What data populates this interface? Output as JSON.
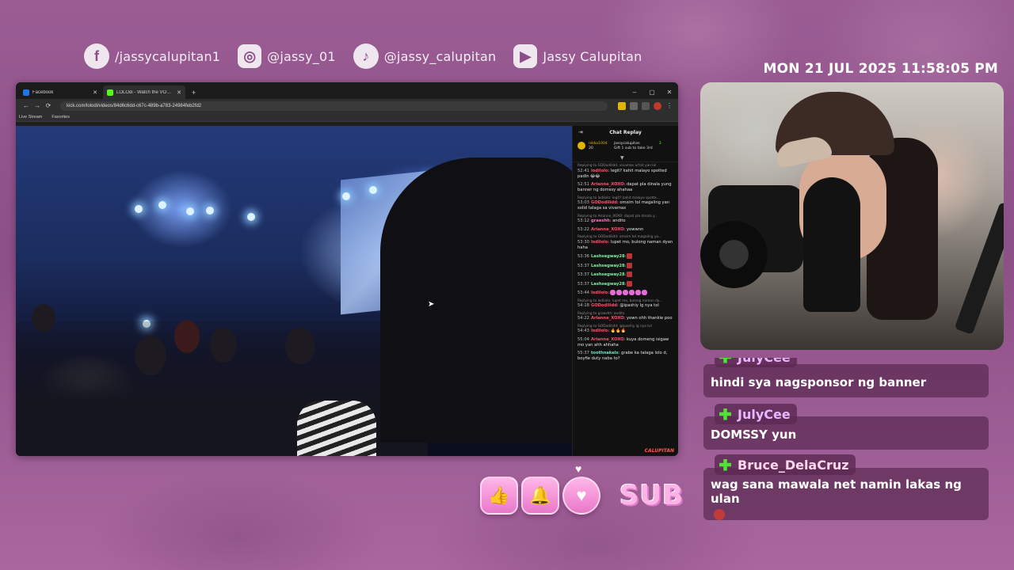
{
  "socials": [
    {
      "icon": "facebook-icon",
      "glyph": "f",
      "label": "/jassycalupitan1"
    },
    {
      "icon": "instagram-icon",
      "glyph": "◎",
      "label": "@jassy_01"
    },
    {
      "icon": "tiktok-icon",
      "glyph": "♪",
      "label": "@jassy_calupitan"
    },
    {
      "icon": "youtube-icon",
      "glyph": "▶",
      "label": "Jassy Calupitan"
    }
  ],
  "clock": "MON 21 JUL 2025 11:58:05 PM",
  "browser": {
    "tabs": [
      {
        "title": "Facebook",
        "fav_color": "#1877f2",
        "active": false
      },
      {
        "title": "LOLOdi - Watch the VOD on",
        "fav_color": "#53fc18",
        "active": true
      }
    ],
    "new_tab": "+",
    "win_controls": [
      "–",
      "▢",
      "✕"
    ],
    "nav": [
      "←",
      "→",
      "⟳"
    ],
    "url": "kick.com/lolodi/videos/84d6c6dd-c67c-489b-a783-24984feb2fd2",
    "bookmarks": [
      "Live Stream",
      "Favorites"
    ]
  },
  "chat_replay": {
    "title": "Chat Replay",
    "pinned": {
      "user": "nikko1004",
      "count": "20",
      "streamer": "jassycalupitan",
      "count2": "3",
      "gift": "Gift 1 sub to take 3rd"
    },
    "messages": [
      {
        "reply": "Replying to GODodilidd: vivamax artist yan lol",
        "ts": "52:41",
        "user": "lodilolo",
        "ucls": "u-red",
        "text": ": legit? kahit malayo spotted padin 😂😂"
      },
      {
        "reply": "",
        "ts": "52:51",
        "user": "Arianne_XOXO",
        "ucls": "u-red",
        "text": ": dapat pla dinala yung banner ng domssy ahahaa"
      },
      {
        "reply": "Replying to lodilolo: legit? kahit malayo spotte...",
        "ts": "53:03",
        "user": "GODodilidd",
        "ucls": "u-red",
        "text": ": omsim tol magaling yan solid talaga sa vivamax"
      },
      {
        "reply": "Replying to Arianne_XOXO: dapat pla dinala y...",
        "ts": "53:12",
        "user": "graeshh",
        "ucls": "u-pink",
        "text": ": andito"
      },
      {
        "reply": "",
        "ts": "53:22",
        "user": "Arianne_XOXO",
        "ucls": "u-red",
        "text": ": yowwnn"
      },
      {
        "reply": "Replying to GODodilidd: omsim tol magaling ya...",
        "ts": "53:30",
        "user": "lodilolo",
        "ucls": "u-red",
        "text": ": lupet mo, bulong naman dyan haha"
      },
      {
        "reply": "",
        "ts": "53:36",
        "user": "Lashsegway28",
        "ucls": "u-green",
        "text": ":"
      },
      {
        "reply": "",
        "ts": "53:37",
        "user": "Lashsegway28",
        "ucls": "u-green",
        "text": ":"
      },
      {
        "reply": "",
        "ts": "53:37",
        "user": "Lashsegway28",
        "ucls": "u-green",
        "text": ":"
      },
      {
        "reply": "",
        "ts": "53:37",
        "user": "Lashsegway28",
        "ucls": "u-green",
        "text": ":"
      },
      {
        "reply": "",
        "ts": "53:44",
        "user": "lodilolo",
        "ucls": "u-red",
        "text": ":"
      },
      {
        "reply": "Replying to lodilolo: lupet mo, bulong naman dy...",
        "ts": "54:18",
        "user": "GODodilidd",
        "ucls": "u-red",
        "text": ": @ipashiy lg nya tol"
      },
      {
        "reply": "Replying to graeshh: andito",
        "ts": "54:22",
        "user": "Arianne_XOXO",
        "ucls": "u-red",
        "text": ": yown ohh thankie poo"
      },
      {
        "reply": "Replying to GODodilidd: @ipashiy lg nya tol",
        "ts": "54:43",
        "user": "lodilolo",
        "ucls": "u-red",
        "text": ": 🔥🔥🔥"
      },
      {
        "reply": "",
        "ts": "55:04",
        "user": "Arianne_XOXO",
        "ucls": "u-red",
        "text": ": kuya domeng isigaw mo yan ahh ahhaha"
      },
      {
        "reply": "",
        "ts": "55:37",
        "user": "toothnakels",
        "ucls": "u-teal",
        "text": ": grabe ka talaga lolo d, boyfie duty naba to?"
      }
    ],
    "logo": "CALUPITAN"
  },
  "overlay_chat": [
    {
      "name": "JulyCee",
      "ncls": "n-violet",
      "text": "hindi sya nagsponsor ng banner"
    },
    {
      "name": "JulyCee",
      "ncls": "n-violet",
      "text": "DOMSSY yun"
    },
    {
      "name": "Bruce_DelaCruz",
      "ncls": "n-pink",
      "text": "wag sana mawala net namin lakas ng ulan"
    }
  ],
  "actions": {
    "like": "👍",
    "bell": "🔔",
    "heart": "♥",
    "sub_label": "SUB"
  }
}
